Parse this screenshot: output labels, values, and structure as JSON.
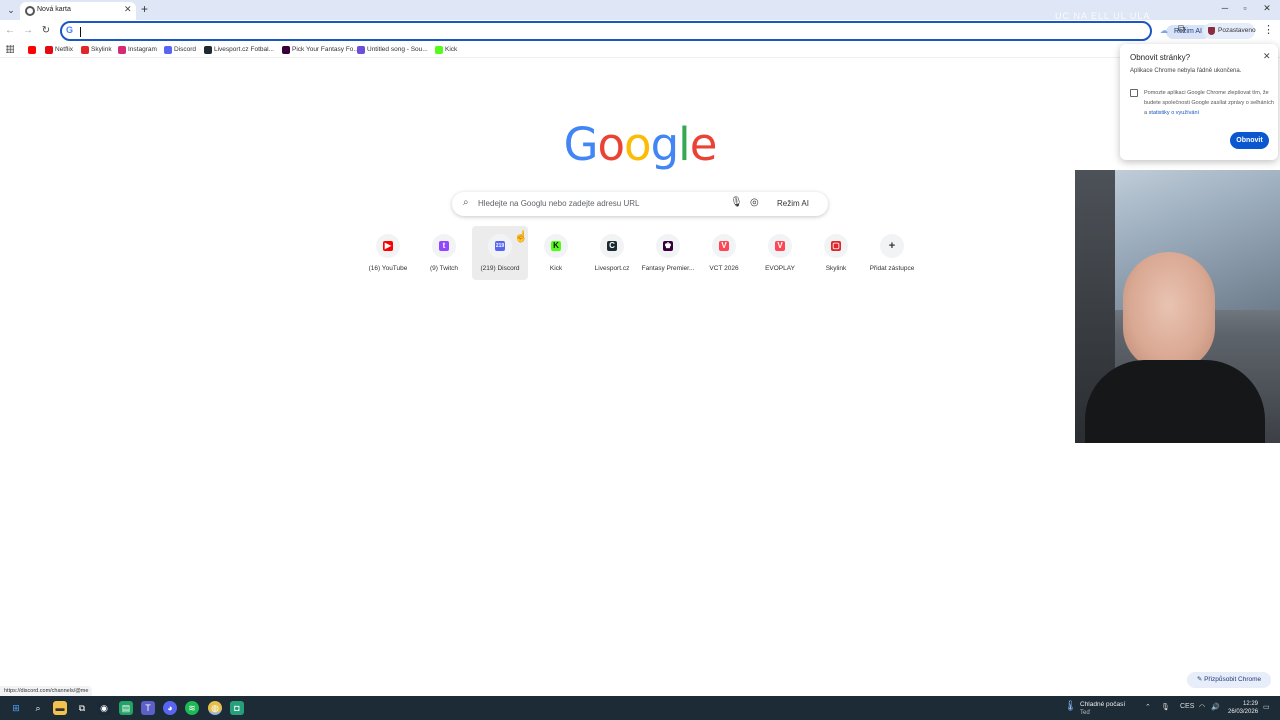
{
  "browser": {
    "tab_title": "Nová karta",
    "ghost_overlay_text": "UC NA  ELL  UL  ULA",
    "omnibox": {
      "value": "",
      "ai_mode_label": "Režim AI"
    },
    "profile_label": "Pozastaveno"
  },
  "bookmarks": [
    {
      "label": "",
      "icon": "youtube-icon",
      "color": "#ff0000"
    },
    {
      "label": "Netflix",
      "icon": "netflix-icon",
      "color": "#e50914"
    },
    {
      "label": "Skylink",
      "icon": "skylink-icon",
      "color": "#e0262a"
    },
    {
      "label": "Instagram",
      "icon": "instagram-icon",
      "color": "#d62976"
    },
    {
      "label": "Discord",
      "icon": "discord-icon",
      "color": "#5865f2"
    },
    {
      "label": "Livesport.cz Fotbal...",
      "icon": "livesport-icon",
      "color": "#1b2a33"
    },
    {
      "label": "Pick Your Fantasy Fo...",
      "icon": "premier-league-icon",
      "color": "#37003c"
    },
    {
      "label": "Untitled song - Sou...",
      "icon": "suno-icon",
      "color": "#6b4fd9"
    },
    {
      "label": "Kick",
      "icon": "kick-icon",
      "color": "#53fc18"
    }
  ],
  "search": {
    "placeholder": "Hledejte na Googlu nebo zadejte adresu URL",
    "ai_mode_label": "Režim AI"
  },
  "shortcuts": [
    {
      "label": "(16) YouTube",
      "icon": "youtube-icon",
      "color": "#ff0000",
      "glyph": "▶"
    },
    {
      "label": "(9) Twitch",
      "icon": "twitch-icon",
      "color": "#9146ff",
      "glyph": "t"
    },
    {
      "label": "(219) Discord",
      "icon": "discord-icon",
      "color": "#5865f2",
      "glyph": "219"
    },
    {
      "label": "Kick",
      "icon": "kick-icon",
      "color": "#53fc18",
      "glyph": "K"
    },
    {
      "label": "Livesport.cz",
      "icon": "livesport-icon",
      "color": "#1b2a33",
      "glyph": "C"
    },
    {
      "label": "Fantasy Premier...",
      "icon": "premier-league-icon",
      "color": "#37003c",
      "glyph": "♚"
    },
    {
      "label": "VCT 2026",
      "icon": "valorant-icon",
      "color": "#ff4655",
      "glyph": "V"
    },
    {
      "label": "EVOPLAY",
      "icon": "valorant-icon",
      "color": "#ff4655",
      "glyph": "V"
    },
    {
      "label": "Skylink",
      "icon": "skylink-icon",
      "color": "#e0262a",
      "glyph": "▢"
    },
    {
      "label": "Přidat zástupce",
      "icon": "plus-icon",
      "color": "#333333",
      "glyph": "+"
    }
  ],
  "restore_popup": {
    "title": "Obnovit stránky?",
    "message": "Aplikace Chrome nebyla řádně ukončena.",
    "checkbox_text": "Pomozte aplikaci Google Chrome zlepšovat tím, že budete společnosti Google zasílat zprávy o selháních a",
    "checkbox_link": "statistiky o využívání",
    "checkbox_checked": false,
    "button_label": "Obnovit"
  },
  "status_url": "https://discord.com/channels/@me",
  "customize_label": "Přizpůsobit Chrome",
  "taskbar": {
    "weather_title": "Chladné počasí",
    "weather_sub": "Teď",
    "language": "CES",
    "time": "12:29",
    "date": "26/03/2026"
  },
  "colors": {
    "accent": "#0b57d0",
    "tab_strip": "#dfe6f5",
    "taskbar": "#1d2b36"
  }
}
